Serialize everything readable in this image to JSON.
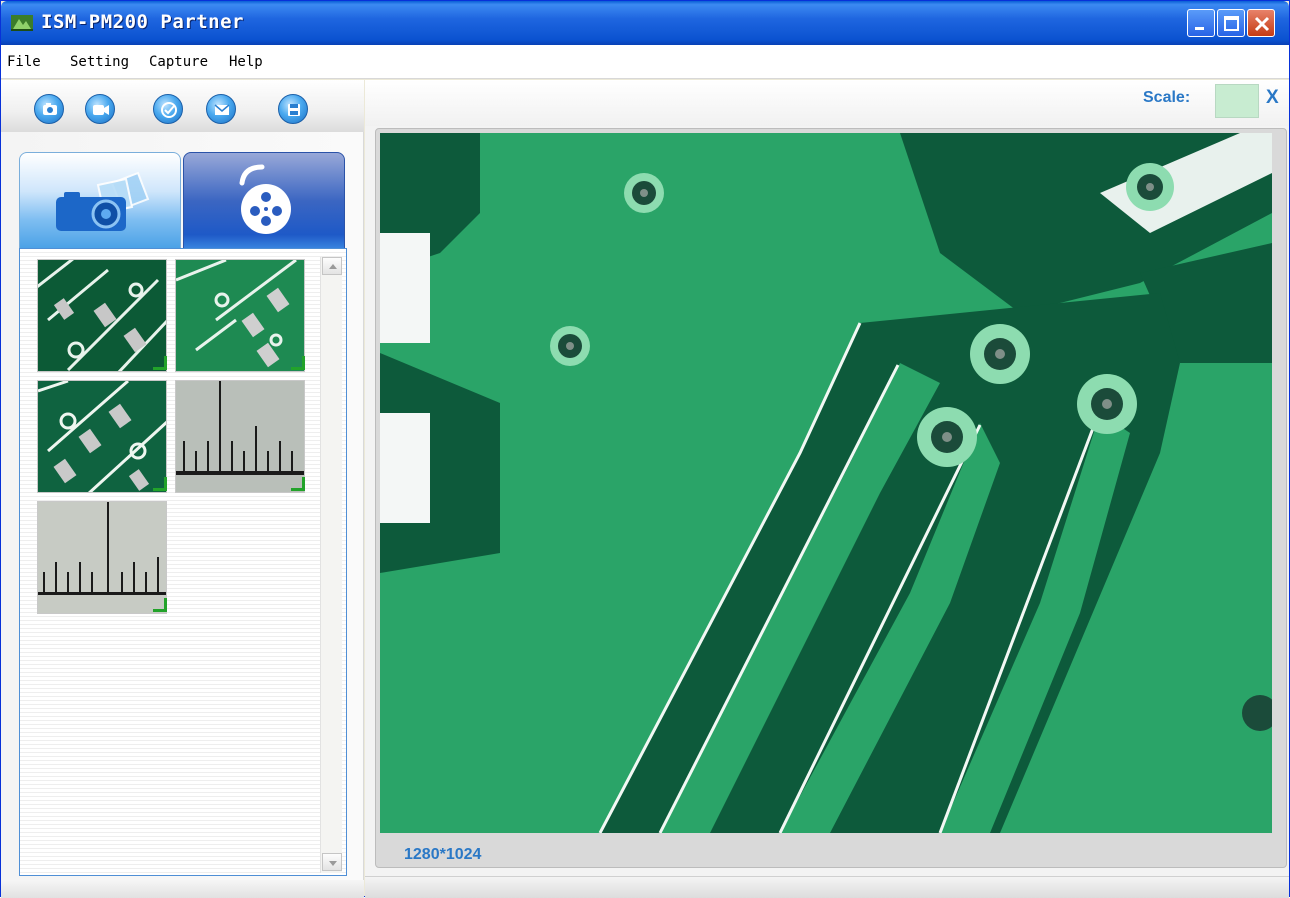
{
  "window": {
    "title": "ISM-PM200 Partner"
  },
  "menu": {
    "items": [
      "File",
      "Setting",
      "Capture",
      "Help"
    ]
  },
  "toolbar": {
    "icons": [
      "camera-icon",
      "video-icon",
      "check-icon",
      "mail-icon",
      "save-icon"
    ]
  },
  "tabs": [
    {
      "name": "photo-tab",
      "icon": "camera-icon",
      "selected": true
    },
    {
      "name": "video-tab",
      "icon": "film-reel-icon",
      "selected": false
    }
  ],
  "thumbnails": [
    {
      "kind": "pcb-closeup"
    },
    {
      "kind": "pcb-wide"
    },
    {
      "kind": "pcb-angled"
    },
    {
      "kind": "ruler-scale"
    },
    {
      "kind": "ruler-scale-large"
    }
  ],
  "scale": {
    "label": "Scale:",
    "close": "X",
    "swatch_color": "#c8ecd1"
  },
  "viewer": {
    "resolution": "1280*1024"
  },
  "colors": {
    "accent": "#2a78c6",
    "pcb_green": "#2aa468",
    "pcb_dark": "#0d5a3b"
  }
}
